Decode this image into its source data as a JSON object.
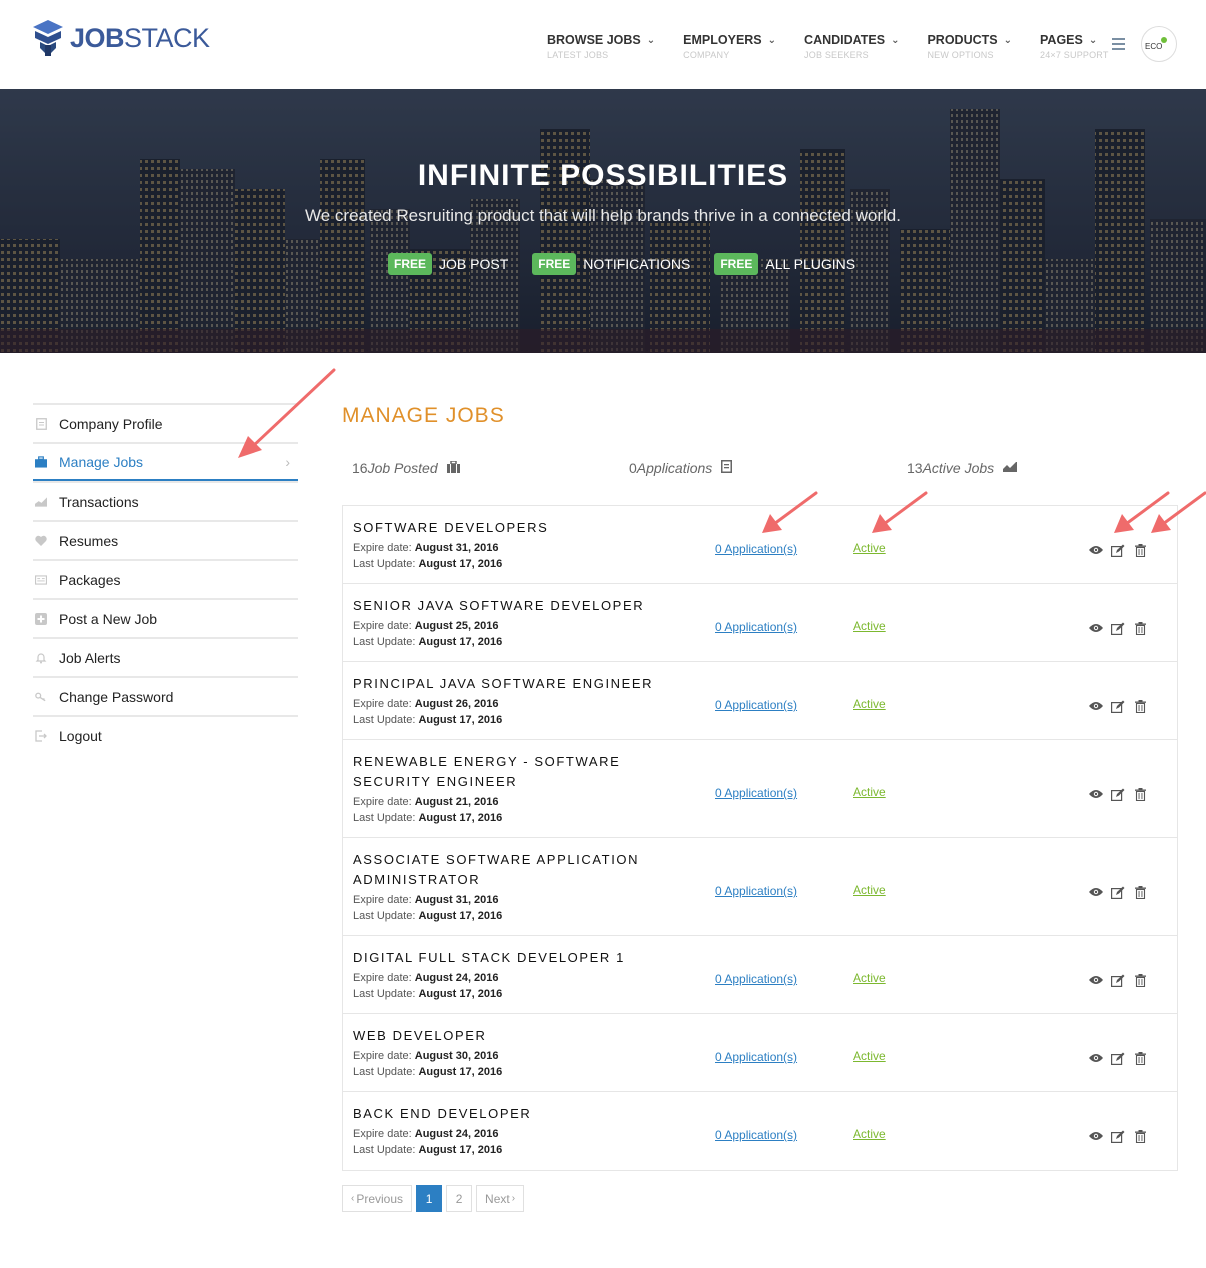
{
  "brand": {
    "logo_text_bold": "JOB",
    "logo_text_light": "STACK"
  },
  "nav": [
    {
      "label": "BROWSE JOBS",
      "sub": "LATEST JOBS"
    },
    {
      "label": "EMPLOYERS",
      "sub": "COMPANY"
    },
    {
      "label": "CANDIDATES",
      "sub": "JOB SEEKERS"
    },
    {
      "label": "PRODUCTS",
      "sub": "NEW OPTIONS"
    },
    {
      "label": "PAGES",
      "sub": "24×7 SUPPORT"
    }
  ],
  "avatar_text": "ECO",
  "hero": {
    "title": "INFINITE  POSSIBILITIES",
    "subtitle": "We created Resruiting product that will help brands thrive in a connected world.",
    "badges": [
      {
        "tag": "FREE",
        "label": "JOB POST"
      },
      {
        "tag": "FREE",
        "label": "NOTIFICATIONS"
      },
      {
        "tag": "FREE",
        "label": "ALL PLUGINS"
      }
    ]
  },
  "sidebar": {
    "items": [
      {
        "label": "Company Profile",
        "icon": "document-icon"
      },
      {
        "label": "Manage Jobs",
        "icon": "briefcase-icon"
      },
      {
        "label": "Transactions",
        "icon": "chart-icon"
      },
      {
        "label": "Resumes",
        "icon": "heart-icon"
      },
      {
        "label": "Packages",
        "icon": "package-icon"
      },
      {
        "label": "Post a New Job",
        "icon": "plus-icon"
      },
      {
        "label": "Job Alerts",
        "icon": "bell-icon"
      },
      {
        "label": "Change Password",
        "icon": "key-icon"
      },
      {
        "label": "Logout",
        "icon": "logout-icon"
      }
    ],
    "active_index": 1
  },
  "main": {
    "title": "MANAGE JOBS",
    "stats": {
      "posted_num": "16",
      "posted_label": "Job Posted",
      "apps_num": "0",
      "apps_label": "Applications",
      "active_num": "13",
      "active_label": "Active Jobs"
    },
    "expire_label": "Expire date:",
    "update_label": "Last Update:",
    "jobs": [
      {
        "title": "SOFTWARE DEVELOPERS",
        "expire": "August 31, 2016",
        "updated": "August 17, 2016",
        "apps": "0 Application(s)",
        "status": "Active"
      },
      {
        "title": "SENIOR JAVA SOFTWARE DEVELOPER",
        "expire": "August 25, 2016",
        "updated": "August 17, 2016",
        "apps": "0 Application(s)",
        "status": "Active"
      },
      {
        "title": "PRINCIPAL JAVA SOFTWARE ENGINEER",
        "expire": "August 26, 2016",
        "updated": "August 17, 2016",
        "apps": "0 Application(s)",
        "status": "Active"
      },
      {
        "title": "RENEWABLE ENERGY - SOFTWARE SECURITY ENGINEER",
        "expire": "August 21, 2016",
        "updated": "August 17, 2016",
        "apps": "0 Application(s)",
        "status": "Active"
      },
      {
        "title": "ASSOCIATE SOFTWARE APPLICATION ADMINISTRATOR",
        "expire": "August 31, 2016",
        "updated": "August 17, 2016",
        "apps": "0 Application(s)",
        "status": "Active"
      },
      {
        "title": "DIGITAL FULL STACK DEVELOPER 1",
        "expire": "August 24, 2016",
        "updated": "August 17, 2016",
        "apps": "0 Application(s)",
        "status": "Active"
      },
      {
        "title": "WEB DEVELOPER",
        "expire": "August 30, 2016",
        "updated": "August 17, 2016",
        "apps": "0 Application(s)",
        "status": "Active"
      },
      {
        "title": "BACK END DEVELOPER",
        "expire": "August 24, 2016",
        "updated": "August 17, 2016",
        "apps": "0 Application(s)",
        "status": "Active"
      }
    ]
  },
  "pagination": {
    "prev": "Previous",
    "pages": [
      "1",
      "2"
    ],
    "current": "1",
    "next": "Next"
  },
  "colors": {
    "accent": "#2c7fc3",
    "title_orange": "#e0902a",
    "status_green": "#7cb82f",
    "free_green": "#5cb85c",
    "arrow": "#ef6b6b"
  }
}
